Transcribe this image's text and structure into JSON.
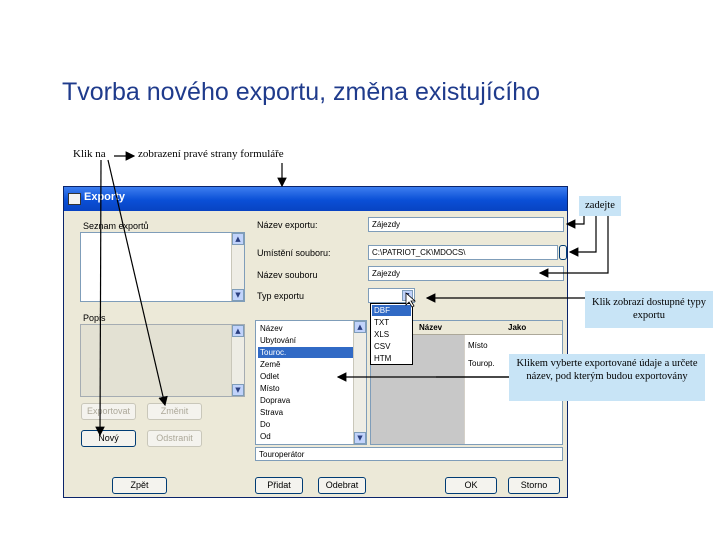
{
  "slide": {
    "title": "Tvorba nového exportu, změna existujícího",
    "note_click": "Klik na",
    "note_display": "zobrazení pravé strany formuláře"
  },
  "window": {
    "title": "Exporty",
    "saved_label": "Seznam exportů",
    "desc_label": "Popis",
    "export_name_label": "Název exportu:",
    "export_name_value": "Zájezdy",
    "location_label": "Umístění souboru:",
    "location_value": "C:\\PATRIOT_CK\\MDOCS\\",
    "filename_label": "Název souboru",
    "filename_value": "Zajezdy",
    "type_label": "Typ exportu",
    "type_options": [
      "DBF",
      "TXT",
      "XLS",
      "CSV",
      "HTM"
    ],
    "type_selected_index": 0,
    "fields_list": [
      "Název",
      "Ubytování",
      "Touroc.",
      "Země",
      "Odlet",
      "Místo",
      "Doprava",
      "Strava",
      "Do",
      "Od"
    ],
    "fields_selected_index": 2,
    "grid_headers": [
      "Název",
      "Jako"
    ],
    "grid_rows": [
      [
        "",
        "Místo"
      ],
      [
        "",
        "Tourop."
      ]
    ],
    "bottom_field": "Touroperátor",
    "buttons": {
      "export": "Exportovat",
      "change": "Změnit",
      "new": "Nový",
      "delete": "Odstranit",
      "back": "Zpět",
      "add": "Přidat",
      "remove": "Odebrat",
      "ok": "OK",
      "cancel": "Storno"
    }
  },
  "callouts": {
    "enter": "zadejte",
    "click_shows": "Klik zobrazí dostupné typy exportu",
    "choose": "Klikem vyberte exportované údaje a určete název, pod kterým budou exportovány"
  },
  "colors": {
    "title": "#1f3b8c",
    "titlebar": "#0a4fd6",
    "callout": "#c8e4f6",
    "selection": "#316ac5"
  }
}
